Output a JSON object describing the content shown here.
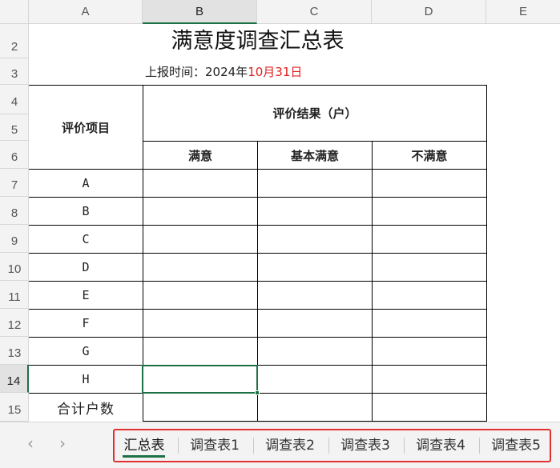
{
  "columns": [
    "A",
    "B",
    "C",
    "D",
    "E"
  ],
  "rows": [
    "2",
    "3",
    "4",
    "5",
    "6",
    "7",
    "8",
    "9",
    "10",
    "11",
    "12",
    "13",
    "14",
    "15"
  ],
  "sheet": {
    "title": "满意度调查汇总表",
    "subtitle_prefix": "上报时间：2024年",
    "subtitle_red": "10月31日",
    "header_item": "评价项目",
    "header_result": "评价结果（户）",
    "subheaders": [
      "满意",
      "基本满意",
      "不满意"
    ],
    "items": [
      "A",
      "B",
      "C",
      "D",
      "E",
      "F",
      "G",
      "H"
    ],
    "total_label": "合计户数"
  },
  "tabs": [
    "汇总表",
    "调查表1",
    "调查表2",
    "调查表3",
    "调查表4",
    "调查表5"
  ],
  "nav": {
    "prev": "‹",
    "next": "›"
  },
  "selection": {
    "cell": "B14"
  },
  "colors": {
    "accent": "#1e7145",
    "highlight": "#e03030",
    "date_red": "#e02020"
  }
}
